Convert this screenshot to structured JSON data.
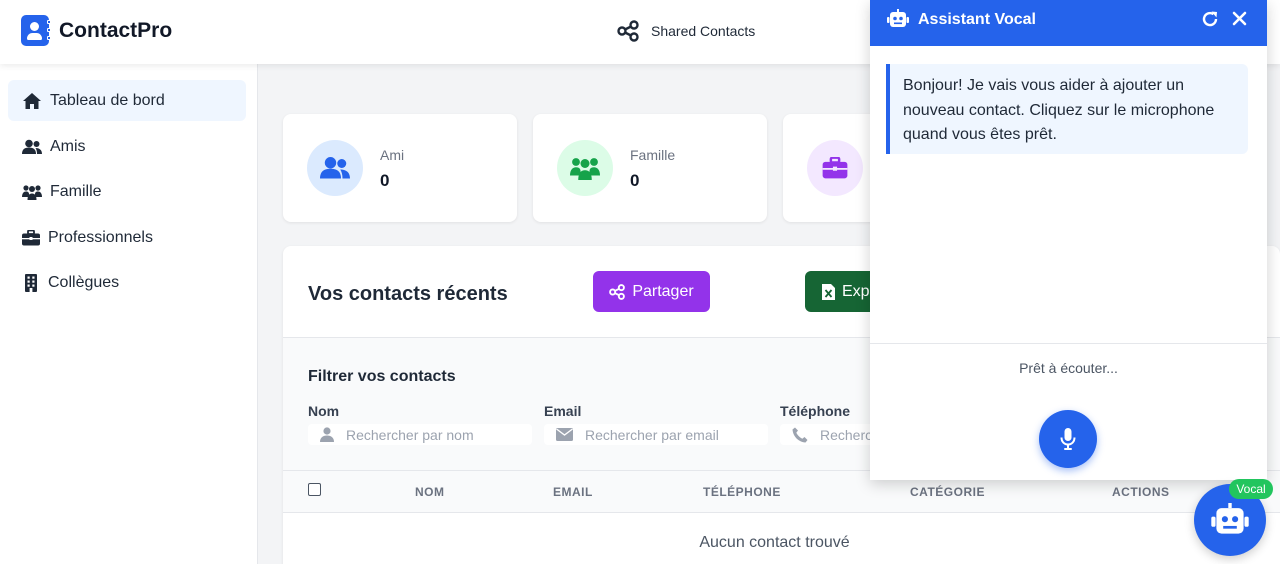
{
  "app": {
    "name": "ContactPro"
  },
  "header": {
    "shared_label": "Shared Contacts"
  },
  "sidebar": {
    "items": [
      {
        "label": "Tableau de bord",
        "icon": "home-icon",
        "active": true
      },
      {
        "label": "Amis",
        "icon": "users-icon"
      },
      {
        "label": "Famille",
        "icon": "family-icon"
      },
      {
        "label": "Professionnels",
        "icon": "briefcase-icon"
      },
      {
        "label": "Collègues",
        "icon": "building-icon"
      }
    ]
  },
  "stats": [
    {
      "label": "Ami",
      "value": "0",
      "color": "#2563eb",
      "bg": "#dbeafe"
    },
    {
      "label": "Famille",
      "value": "0",
      "color": "#16a34a",
      "bg": "#dcfce7"
    },
    {
      "label": "",
      "value": "",
      "color": "#9333ea",
      "bg": "#f3e8ff"
    }
  ],
  "recent": {
    "title": "Vos contacts récents",
    "share_label": "Partager",
    "export_label": "Exp",
    "share_color": "#9333ea",
    "export_color": "#166534"
  },
  "filters": {
    "title": "Filtrer vos contacts",
    "fields": [
      {
        "label": "Nom",
        "placeholder": "Rechercher par nom"
      },
      {
        "label": "Email",
        "placeholder": "Rechercher par email"
      },
      {
        "label": "Téléphone",
        "placeholder": "Recherc"
      }
    ]
  },
  "table": {
    "columns": [
      "NOM",
      "EMAIL",
      "TÉLÉPHONE",
      "CATÉGORIE",
      "ACTIONS"
    ],
    "empty_message": "Aucun contact trouvé"
  },
  "assistant": {
    "title": "Assistant Vocal",
    "message": "Bonjour! Je vais vous aider à ajouter un nouveau contact. Cliquez sur le microphone quand vous êtes prêt.",
    "status": "Prêt à écouter...",
    "badge": "Vocal",
    "accent": "#2563eb"
  }
}
